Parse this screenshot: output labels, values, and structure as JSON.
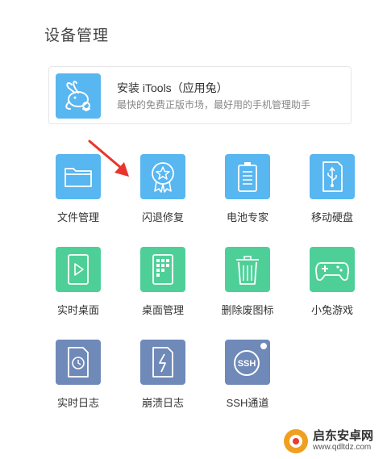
{
  "page_title": "设备管理",
  "banner": {
    "title": "安装 iTools（应用兔）",
    "subtitle": "最快的免费正版市场，最好用的手机管理助手",
    "icon": "rabbit-icon",
    "color": "#58b6f0"
  },
  "colors": {
    "blue": "#58b6f0",
    "green": "#4fcf98",
    "slate": "#6f89b8",
    "arrow": "#e8352c"
  },
  "tiles": [
    {
      "label": "文件管理",
      "icon": "folder-icon"
    },
    {
      "label": "闪退修复",
      "icon": "badge-star-icon"
    },
    {
      "label": "电池专家",
      "icon": "battery-icon"
    },
    {
      "label": "移动硬盘",
      "icon": "usb-drive-icon"
    },
    {
      "label": "实时桌面",
      "icon": "play-icon"
    },
    {
      "label": "桌面管理",
      "icon": "grid-icon"
    },
    {
      "label": "删除废图标",
      "icon": "trash-icon"
    },
    {
      "label": "小兔游戏",
      "icon": "gamepad-icon"
    },
    {
      "label": "实时日志",
      "icon": "clock-doc-icon"
    },
    {
      "label": "崩溃日志",
      "icon": "lightning-doc-icon"
    },
    {
      "label": "SSH通道",
      "icon": "ssh-icon",
      "badge": "SSH"
    }
  ],
  "watermark": {
    "name": "启东安卓网",
    "url": "www.qdltdz.com"
  }
}
